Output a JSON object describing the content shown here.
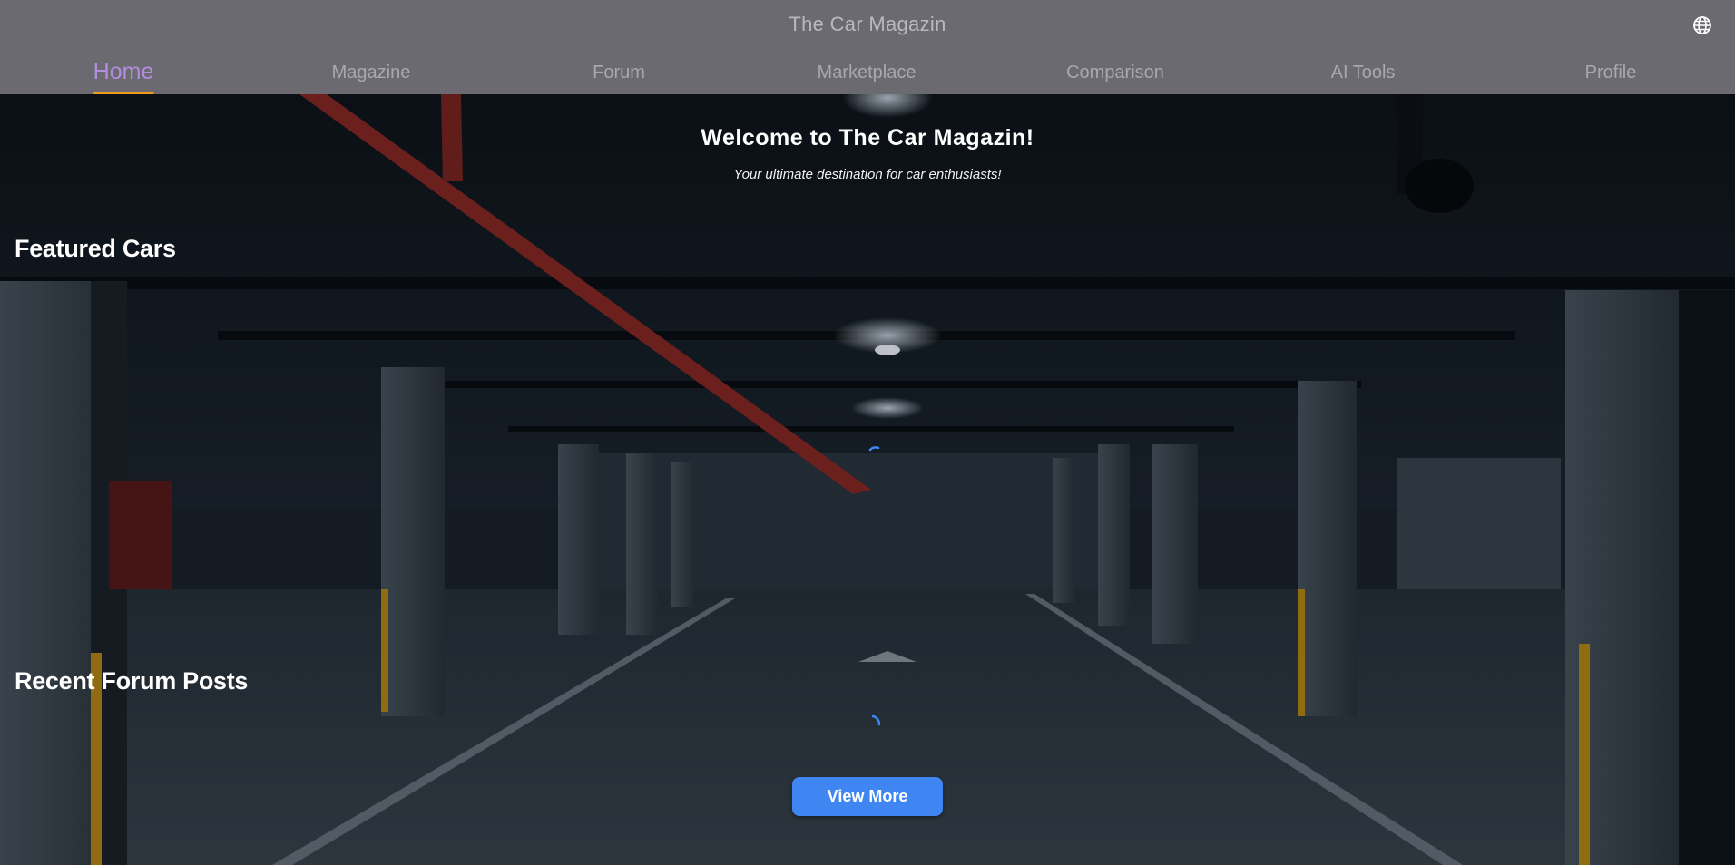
{
  "header": {
    "title": "The Car Magazin",
    "language_icon": "globe-icon"
  },
  "nav": {
    "tabs": [
      {
        "label": "Home",
        "active": true
      },
      {
        "label": "Magazine",
        "active": false
      },
      {
        "label": "Forum",
        "active": false
      },
      {
        "label": "Marketplace",
        "active": false
      },
      {
        "label": "Comparison",
        "active": false
      },
      {
        "label": "AI Tools",
        "active": false
      },
      {
        "label": "Profile",
        "active": false
      }
    ]
  },
  "hero": {
    "title": "Welcome to The Car Magazin!",
    "subtitle": "Your ultimate destination for car enthusiasts!"
  },
  "sections": {
    "featured_title": "Featured Cars",
    "forum_title": "Recent Forum Posts"
  },
  "actions": {
    "view_more_label": "View More"
  },
  "colors": {
    "header_bg": "#6b6a70",
    "active_tab": "#b38de0",
    "tab_indicator": "#f09a1e",
    "button_bg": "#3f86f2",
    "spinner": "#3f86f2"
  }
}
